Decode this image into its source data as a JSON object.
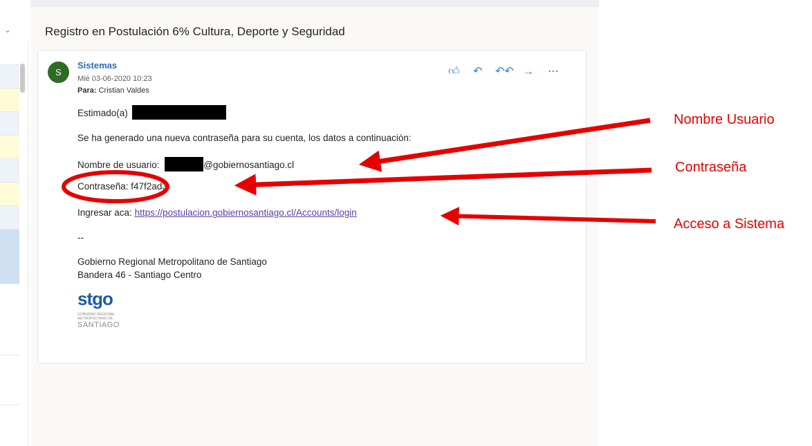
{
  "email": {
    "subject": "Registro en Postulación 6% Cultura, Deporte y Seguridad",
    "avatar_initial": "S",
    "sender": "Sistemas",
    "date": "Mié 03-06-2020 10:23",
    "to_label": "Para:",
    "to_name": "Cristian Valdes",
    "greeting": "Estimado(a)",
    "intro": "Se ha generado una nueva contraseña para su cuenta, los datos a continuación:",
    "username_label": "Nombre de usuario:",
    "username_domain": "@gobiernosantiago.cl",
    "password_line": "Contraseña: f47f2ad3",
    "login_label": "Ingresar aca:",
    "login_url": "https://postulacion.gobiernosantiago.cl/Accounts/login",
    "separator": "--",
    "sig_org": "Gobierno Regional Metropolitano de Santiago",
    "sig_address": "Bandera 46 - Santiago Centro",
    "logo_text": "stgo",
    "logo_small": "GOBIERNO REGIONAL METROPOLITANO DE",
    "logo_city": "SANTIAGO"
  },
  "actions": {
    "like": "like-icon",
    "reply": "reply-icon",
    "reply_all": "reply-all-icon",
    "forward": "forward-icon",
    "more": "more-icon"
  },
  "annotations": {
    "username": "Nombre Usuario",
    "password": "Contraseña",
    "access": "Acceso a Sistema",
    "color": "#e60000"
  },
  "colors": {
    "avatar": "#2e6b25",
    "sender": "#2b6cb8",
    "link": "#5b3fa6"
  }
}
